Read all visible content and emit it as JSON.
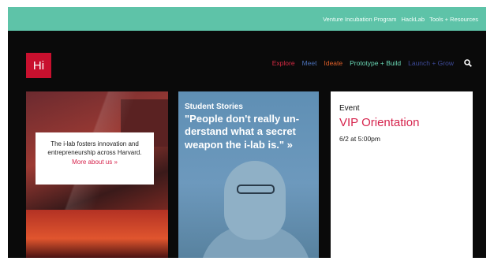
{
  "topbar": {
    "links": [
      "Venture Incubation Program",
      "HackLab",
      "Tools + Resources"
    ],
    "bg": "#5ec3a8"
  },
  "logo": {
    "text": "Hi",
    "color": "#c8102e"
  },
  "mainnav": {
    "items": [
      {
        "label": "Explore",
        "color": "#d62a43"
      },
      {
        "label": "Meet",
        "color": "#4a6fb5"
      },
      {
        "label": "Ideate",
        "color": "#e0602a"
      },
      {
        "label": "Prototype + Build",
        "color": "#6ad6b4"
      },
      {
        "label": "Launch + Grow",
        "color": "#3e4b9a"
      }
    ],
    "search_icon": "search-icon"
  },
  "about": {
    "text": "The i-lab fosters innovation and entrepreneurship across Harvard.",
    "link": "More about us »"
  },
  "story": {
    "heading": "Student Stories",
    "quote": "\"People don't really un-derstand what a secret weapon the i-lab is.\" »"
  },
  "event": {
    "label": "Event",
    "title": "VIP Orientation",
    "date": "6/2 at 5:00pm"
  }
}
